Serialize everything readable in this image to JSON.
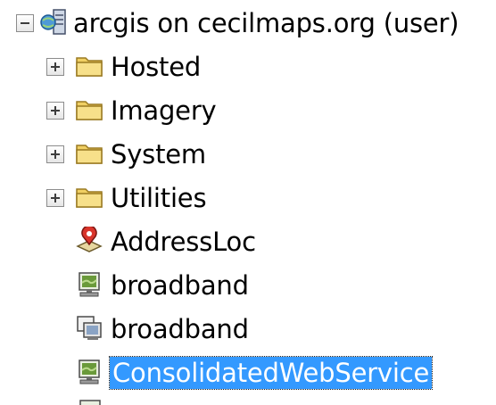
{
  "tree": {
    "root": {
      "label": "arcgis on cecilmaps.org (user)",
      "expanded": true,
      "icon": "server-connection-icon"
    },
    "folders": [
      {
        "label": "Hosted",
        "icon": "folder-icon",
        "expanded": false
      },
      {
        "label": "Imagery",
        "icon": "folder-icon",
        "expanded": false
      },
      {
        "label": "System",
        "icon": "folder-icon",
        "expanded": false
      },
      {
        "label": "Utilities",
        "icon": "folder-icon",
        "expanded": false
      }
    ],
    "services": [
      {
        "label": "AddressLoc",
        "icon": "geocode-service-icon"
      },
      {
        "label": "broadband",
        "icon": "map-service-icon"
      },
      {
        "label": "broadband",
        "icon": "feature-service-icon"
      },
      {
        "label": "ConsolidatedWebService",
        "icon": "map-service-icon",
        "selected": true
      }
    ]
  },
  "colors": {
    "selection": "#3399ff",
    "folder": "#f0cf63",
    "monitor": "#6a9a3a"
  }
}
